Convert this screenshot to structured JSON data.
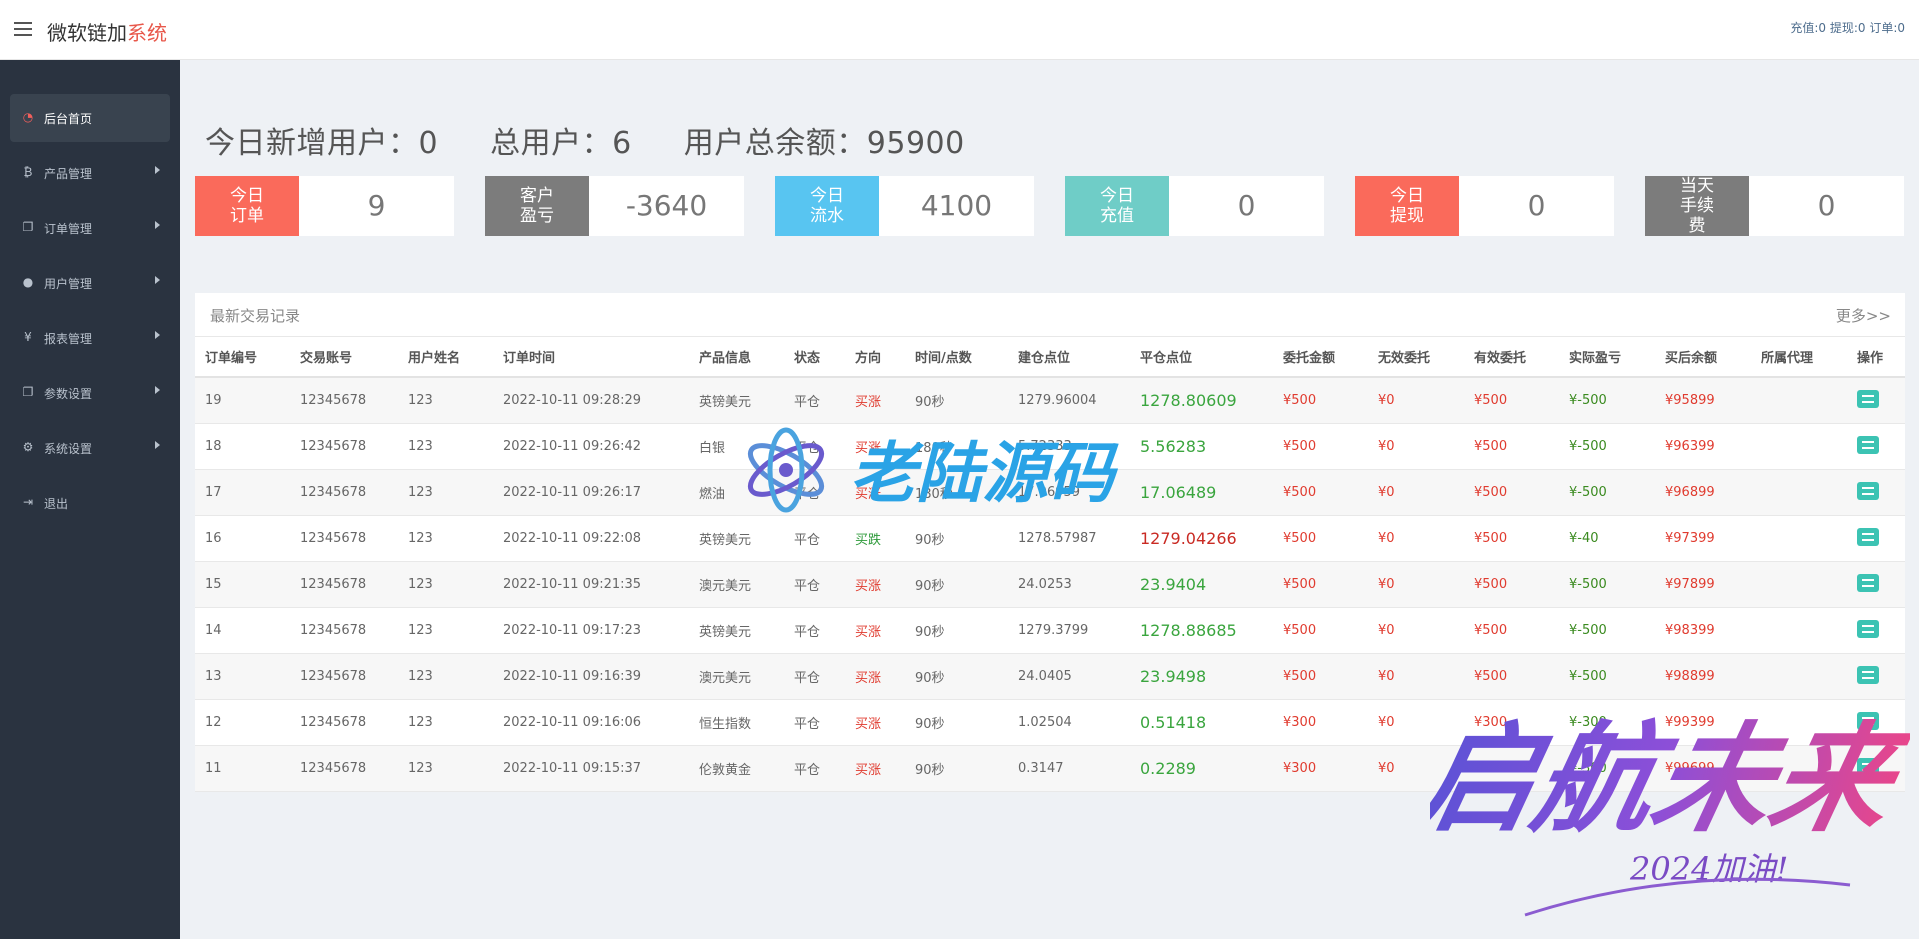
{
  "header": {
    "brand_main": "微软链加",
    "brand_highlight": "系统",
    "top_right": "充值:0 提现:0 订单:0"
  },
  "sidebar": {
    "items": [
      {
        "label": "后台首页",
        "icon": "dashboard-icon"
      },
      {
        "label": "产品管理",
        "icon": "bitcoin-icon"
      },
      {
        "label": "订单管理",
        "icon": "copy-icon"
      },
      {
        "label": "用户管理",
        "icon": "user-icon"
      },
      {
        "label": "报表管理",
        "icon": "yen-icon"
      },
      {
        "label": "参数设置",
        "icon": "copy-icon"
      },
      {
        "label": "系统设置",
        "icon": "cogs-icon"
      },
      {
        "label": "退出",
        "icon": "signout-icon"
      }
    ]
  },
  "summary": {
    "new_users": "今日新增用户：0",
    "total_users": "总用户：6",
    "total_balance": "用户总余额：95900"
  },
  "stats": [
    {
      "label": "今日订单",
      "value": "9",
      "color": "#fa6a5b"
    },
    {
      "label": "客户盈亏",
      "value": "-3640",
      "color": "#7c7c7c"
    },
    {
      "label": "今日流水",
      "value": "4100",
      "color": "#58c5f1"
    },
    {
      "label": "今日充值",
      "value": "0",
      "color": "#6fcdc7"
    },
    {
      "label": "今日提现",
      "value": "0",
      "color": "#fa6a5b"
    },
    {
      "label": "当天手续费",
      "value": "0",
      "color": "#7c7c7c"
    }
  ],
  "table": {
    "title": "最新交易记录",
    "more": "更多>>",
    "headers": [
      "订单编号",
      "交易账号",
      "用户姓名",
      "订单时间",
      "产品信息",
      "状态",
      "方向",
      "时间/点数",
      "建仓点位",
      "平仓点位",
      "委托金额",
      "无效委托",
      "有效委托",
      "实际盈亏",
      "买后余额",
      "所属代理",
      "操作"
    ],
    "rows": [
      [
        "19",
        "12345678",
        "123",
        "2022-10-11 09:28:29",
        "英镑美元",
        "平仓",
        "买涨",
        "90秒",
        "1279.96004",
        "1278.80609",
        "¥500",
        "¥0",
        "¥500",
        "¥-500",
        "¥95899",
        ""
      ],
      [
        "18",
        "12345678",
        "123",
        "2022-10-11 09:26:42",
        "白银",
        "平仓",
        "买涨",
        "180秒",
        "5.72333",
        "5.56283",
        "¥500",
        "¥0",
        "¥500",
        "¥-500",
        "¥96399",
        ""
      ],
      [
        "17",
        "12345678",
        "123",
        "2022-10-11 09:26:17",
        "燃油",
        "平仓",
        "买涨",
        "180秒",
        "17.06959",
        "17.06489",
        "¥500",
        "¥0",
        "¥500",
        "¥-500",
        "¥96899",
        ""
      ],
      [
        "16",
        "12345678",
        "123",
        "2022-10-11 09:22:08",
        "英镑美元",
        "平仓",
        "买跌",
        "90秒",
        "1278.57987",
        "1279.04266",
        "¥500",
        "¥0",
        "¥500",
        "¥-40",
        "¥97399",
        ""
      ],
      [
        "15",
        "12345678",
        "123",
        "2022-10-11 09:21:35",
        "澳元美元",
        "平仓",
        "买涨",
        "90秒",
        "24.0253",
        "23.9404",
        "¥500",
        "¥0",
        "¥500",
        "¥-500",
        "¥97899",
        ""
      ],
      [
        "14",
        "12345678",
        "123",
        "2022-10-11 09:17:23",
        "英镑美元",
        "平仓",
        "买涨",
        "90秒",
        "1279.3799",
        "1278.88685",
        "¥500",
        "¥0",
        "¥500",
        "¥-500",
        "¥98399",
        ""
      ],
      [
        "13",
        "12345678",
        "123",
        "2022-10-11 09:16:39",
        "澳元美元",
        "平仓",
        "买涨",
        "90秒",
        "24.0405",
        "23.9498",
        "¥500",
        "¥0",
        "¥500",
        "¥-500",
        "¥98899",
        ""
      ],
      [
        "12",
        "12345678",
        "123",
        "2022-10-11 09:16:06",
        "恒生指数",
        "平仓",
        "买涨",
        "90秒",
        "1.02504",
        "0.51418",
        "¥300",
        "¥0",
        "¥300",
        "¥-300",
        "¥99399",
        ""
      ],
      [
        "11",
        "12345678",
        "123",
        "2022-10-11 09:15:37",
        "伦敦黄金",
        "平仓",
        "买涨",
        "90秒",
        "0.3147",
        "0.2289",
        "¥300",
        "¥0",
        "¥300",
        "¥-300",
        "¥99699",
        ""
      ]
    ]
  },
  "watermarks": {
    "site": "老陆源码",
    "slogan": "启航未来",
    "slogan_sub": "2024加油!"
  }
}
